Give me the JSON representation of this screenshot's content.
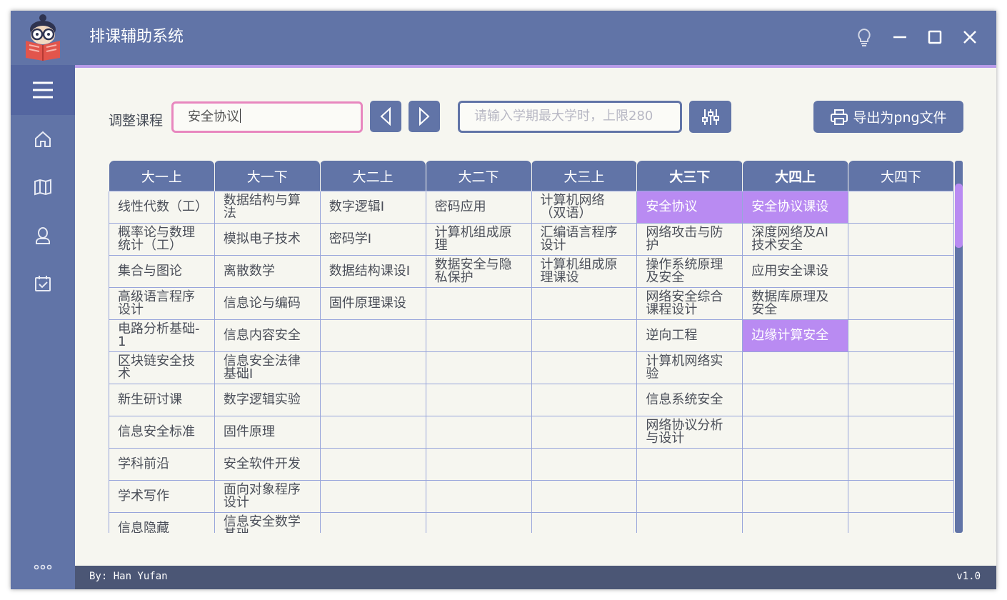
{
  "app": {
    "title": "排课辅助系统"
  },
  "titlebar": {
    "buttons": [
      "lightbulb-icon",
      "minimize-icon",
      "maximize-icon",
      "close-icon"
    ]
  },
  "sidebar": {
    "items": [
      "menu-icon",
      "home-icon",
      "book-icon",
      "user-icon",
      "calendar-check-icon",
      "more-icon"
    ]
  },
  "toolbar": {
    "adjust_label": "调整课程",
    "course_value": "安全协议",
    "hours_placeholder": "请输入学期最大学时，上限280",
    "export_label": "导出为png文件"
  },
  "table": {
    "headers": [
      "大一上",
      "大一下",
      "大二上",
      "大二下",
      "大三上",
      "大三下",
      "大四上",
      "大四下"
    ],
    "bold_headers": [
      5,
      6
    ],
    "rows": [
      [
        "线性代数（工）",
        "数据结构与算法",
        "数字逻辑Ⅰ",
        "密码应用",
        "计算机网络（双语）",
        "安全协议",
        "安全协议课设",
        ""
      ],
      [
        "概率论与数理统计（工）",
        "模拟电子技术",
        "密码学Ⅰ",
        "计算机组成原理",
        "汇编语言程序设计",
        "网络攻击与防护",
        "深度网络及AI技术安全",
        ""
      ],
      [
        "集合与图论",
        "离散数学",
        "数据结构课设Ⅰ",
        "数据安全与隐私保护",
        "计算机组成原理课设",
        "操作系统原理及安全",
        "应用安全课设",
        ""
      ],
      [
        "高级语言程序设计",
        "信息论与编码",
        "固件原理课设",
        "",
        "",
        "网络安全综合课程设计",
        "数据库原理及安全",
        ""
      ],
      [
        "电路分析基础-1",
        "信息内容安全",
        "",
        "",
        "",
        "逆向工程",
        "边缘计算安全",
        ""
      ],
      [
        "区块链安全技术",
        "信息安全法律基础Ⅰ",
        "",
        "",
        "",
        "计算机网络实验",
        "",
        ""
      ],
      [
        "新生研讨课",
        "数字逻辑实验",
        "",
        "",
        "",
        "信息系统安全",
        "",
        ""
      ],
      [
        "信息安全标准",
        "固件原理",
        "",
        "",
        "",
        "网络协议分析与设计",
        "",
        ""
      ],
      [
        "学科前沿",
        "安全软件开发",
        "",
        "",
        "",
        "",
        "",
        ""
      ],
      [
        "学术写作",
        "面向对象程序设计",
        "",
        "",
        "",
        "",
        "",
        ""
      ],
      [
        "信息隐藏",
        "信息安全数学基础",
        "",
        "",
        "",
        "",
        "",
        ""
      ]
    ],
    "highlighted": [
      [
        0,
        5
      ],
      [
        0,
        6
      ],
      [
        4,
        6
      ]
    ]
  },
  "status": {
    "author": "By: Han Yufan",
    "version": "v1.0"
  },
  "colors": {
    "primary": "#6174a7",
    "highlight": "#b98bf2",
    "input_focus_border": "#e887bf",
    "background": "#f6f6f0",
    "statusbar": "#4b5675"
  }
}
